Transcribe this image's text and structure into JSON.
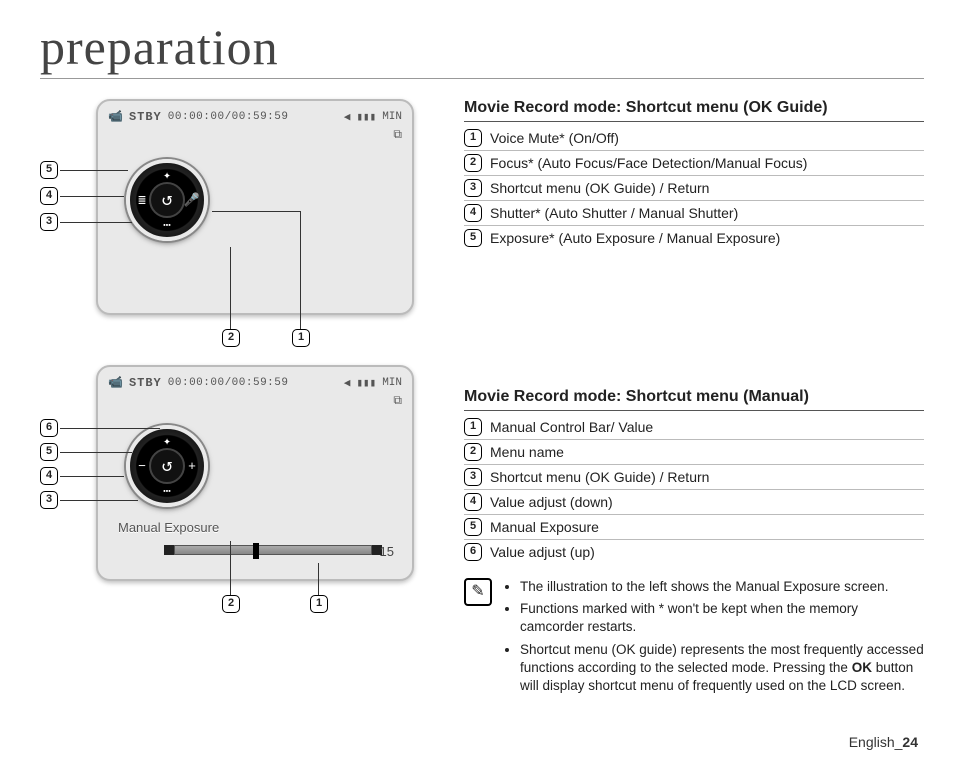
{
  "page_title": "preparation",
  "footer": {
    "prefix": "English_",
    "page": "24"
  },
  "lcd": {
    "status": "STBY",
    "time": "00:00:00/00:59:59",
    "card_label": "◀",
    "battery_label": "▮▮▮",
    "min_label": "MIN",
    "sd_label": "⧉"
  },
  "panel1": {
    "dial": {
      "top": "✦",
      "bottom": "⋯",
      "left": "≣",
      "right": "🎤",
      "center": "↺"
    },
    "callouts_left": [
      "5",
      "4",
      "3"
    ],
    "callouts_bottom_left": "2",
    "callouts_bottom_right": "1"
  },
  "panel2": {
    "dial": {
      "top": "✦",
      "bottom": "⋯",
      "left": "−",
      "right": "+",
      "center": "↺"
    },
    "manual_label": "Manual Exposure",
    "slider_value": "15",
    "callouts_left": [
      "6",
      "5",
      "4",
      "3"
    ],
    "callouts_bottom_left": "2",
    "callouts_bottom_right": "1"
  },
  "section1": {
    "heading": "Movie Record mode: Shortcut menu (OK Guide)",
    "items": [
      {
        "num": "1",
        "text": "Voice Mute* (On/Off)"
      },
      {
        "num": "2",
        "text": "Focus* (Auto Focus/Face Detection/Manual Focus)"
      },
      {
        "num": "3",
        "text": "Shortcut menu (OK Guide) / Return"
      },
      {
        "num": "4",
        "text": "Shutter* (Auto Shutter / Manual Shutter)"
      },
      {
        "num": "5",
        "text": "Exposure* (Auto Exposure / Manual Exposure)"
      }
    ]
  },
  "section2": {
    "heading": "Movie Record mode: Shortcut menu (Manual)",
    "items": [
      {
        "num": "1",
        "text": "Manual Control Bar/ Value"
      },
      {
        "num": "2",
        "text": "Menu name"
      },
      {
        "num": "3",
        "text": "Shortcut menu (OK Guide) / Return"
      },
      {
        "num": "4",
        "text": "Value adjust (down)"
      },
      {
        "num": "5",
        "text": "Manual Exposure"
      },
      {
        "num": "6",
        "text": "Value adjust (up)"
      }
    ]
  },
  "notes": {
    "bullets": [
      "The illustration to the left shows the Manual Exposure screen.",
      "Functions marked with * won't be kept when the memory camcorder restarts.",
      "Shortcut menu (OK guide) represents the most frequently accessed functions according to the selected mode. Pressing the OK button will display shortcut menu of frequently used on the LCD screen."
    ],
    "bold_word": "OK"
  }
}
